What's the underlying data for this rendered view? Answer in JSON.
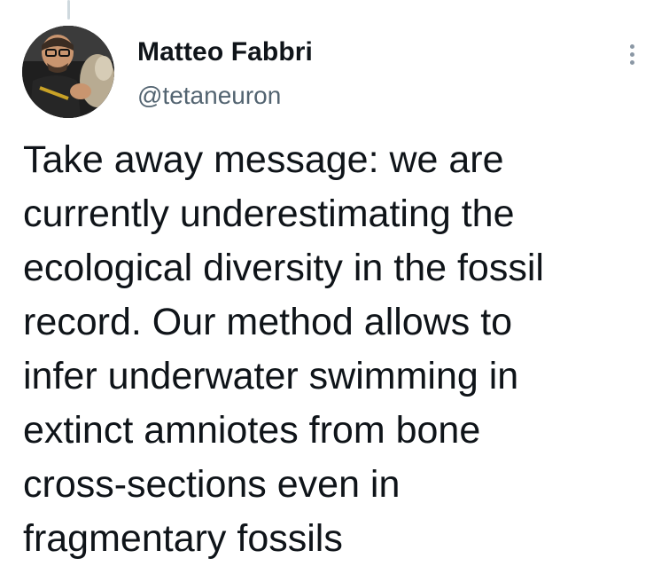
{
  "author": {
    "display_name": "Matteo Fabbri",
    "handle": "@tetaneuron",
    "avatar_icon": "profile-photo"
  },
  "menu": {
    "icon": "more-options-icon"
  },
  "tweet": {
    "lines": [
      "Take away message: we are",
      "currently underestimating the",
      "ecological diversity in the fossil",
      "record. Our method allows to",
      "infer underwater swimming in",
      "extinct amniotes from bone",
      "cross-sections even in",
      "fragmentary fossils"
    ]
  },
  "colors": {
    "text_primary": "#0f1419",
    "text_secondary": "#536471",
    "thread_line": "#cfd9de",
    "icon_muted": "#8b98a5"
  }
}
